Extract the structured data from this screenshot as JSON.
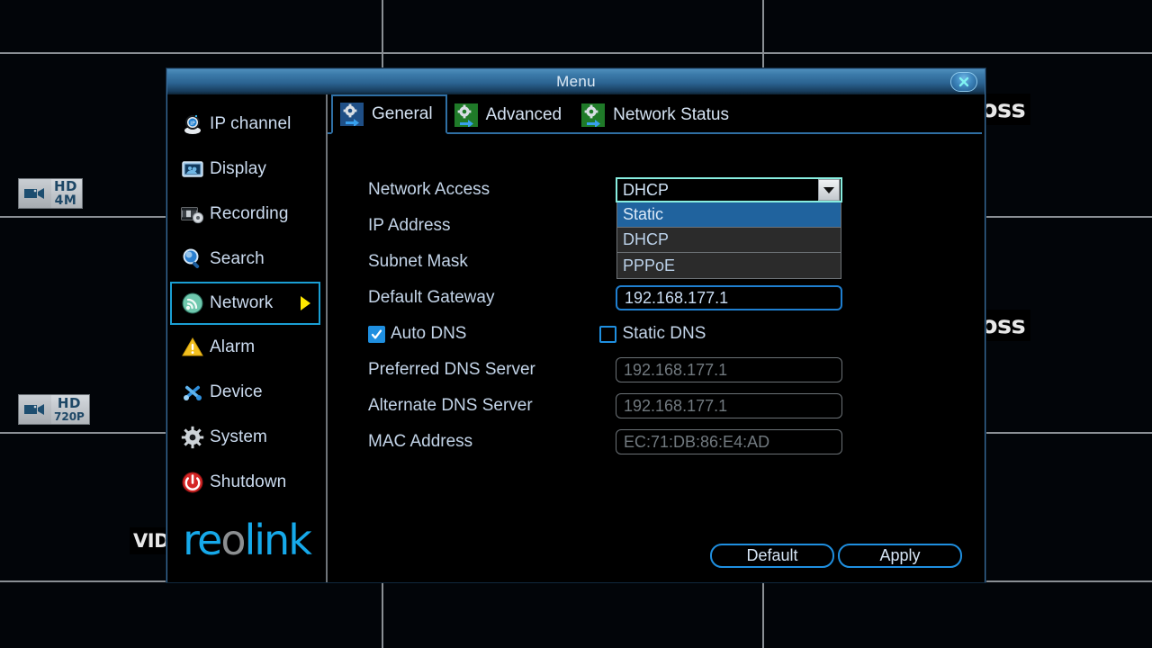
{
  "background": {
    "camera_badges": [
      {
        "name": "badge-hd-4m",
        "line1": "HD",
        "line2": "4M",
        "icon": "camera-icon"
      },
      {
        "name": "badge-hd-720p",
        "line1": "HD",
        "line2": "720P",
        "icon": "camera-icon"
      }
    ],
    "overlay_labels": [
      {
        "text": "oss"
      },
      {
        "text": "oss"
      },
      {
        "text": "VID"
      }
    ]
  },
  "window": {
    "title": "Menu",
    "close_icon": "close-icon"
  },
  "sidebar": {
    "items": [
      {
        "label": "IP channel",
        "icon": "ip-camera-icon",
        "selected": false
      },
      {
        "label": "Display",
        "icon": "display-icon",
        "selected": false
      },
      {
        "label": "Recording",
        "icon": "recording-icon",
        "selected": false
      },
      {
        "label": "Search",
        "icon": "search-icon",
        "selected": false
      },
      {
        "label": "Network",
        "icon": "network-icon",
        "selected": true
      },
      {
        "label": "Alarm",
        "icon": "warning-icon",
        "selected": false
      },
      {
        "label": "Device",
        "icon": "tools-icon",
        "selected": false
      },
      {
        "label": "System",
        "icon": "gear-icon",
        "selected": false
      },
      {
        "label": "Shutdown",
        "icon": "power-icon",
        "selected": false
      }
    ],
    "logo": {
      "pre": "re",
      "dot": "o",
      "post": "link"
    }
  },
  "tabs": [
    {
      "label": "General",
      "icon": "settings-arrow-icon",
      "active": true
    },
    {
      "label": "Advanced",
      "icon": "settings-arrow-icon",
      "active": false
    },
    {
      "label": "Network Status",
      "icon": "settings-arrow-icon",
      "active": false
    }
  ],
  "form": {
    "network_access": {
      "label": "Network Access",
      "value": "DHCP",
      "options": [
        {
          "label": "Static",
          "highlighted": true
        },
        {
          "label": "DHCP",
          "highlighted": false
        },
        {
          "label": "PPPoE",
          "highlighted": false
        }
      ]
    },
    "ip_address": {
      "label": "IP Address",
      "value": ""
    },
    "subnet_mask": {
      "label": "Subnet Mask",
      "value": ""
    },
    "default_gateway": {
      "label": "Default Gateway",
      "value": "192.168.177.1"
    },
    "auto_dns": {
      "label": "Auto DNS",
      "checked": true
    },
    "static_dns": {
      "label": "Static DNS",
      "checked": false
    },
    "preferred_dns": {
      "label": "Preferred DNS Server",
      "value": "192.168.177.1"
    },
    "alternate_dns": {
      "label": "Alternate DNS Server",
      "value": "192.168.177.1"
    },
    "mac_address": {
      "label": "MAC Address",
      "value": "EC:71:DB:86:E4:AD"
    }
  },
  "buttons": {
    "default": "Default",
    "apply": "Apply"
  },
  "colors": {
    "accent_blue": "#1f8fe0",
    "title_blue": "#2b6391",
    "highlight_row": "#20639e",
    "combo_border": "#88eee0",
    "arrow_yellow": "#ffe800",
    "logo_blue": "#16a9ea"
  }
}
